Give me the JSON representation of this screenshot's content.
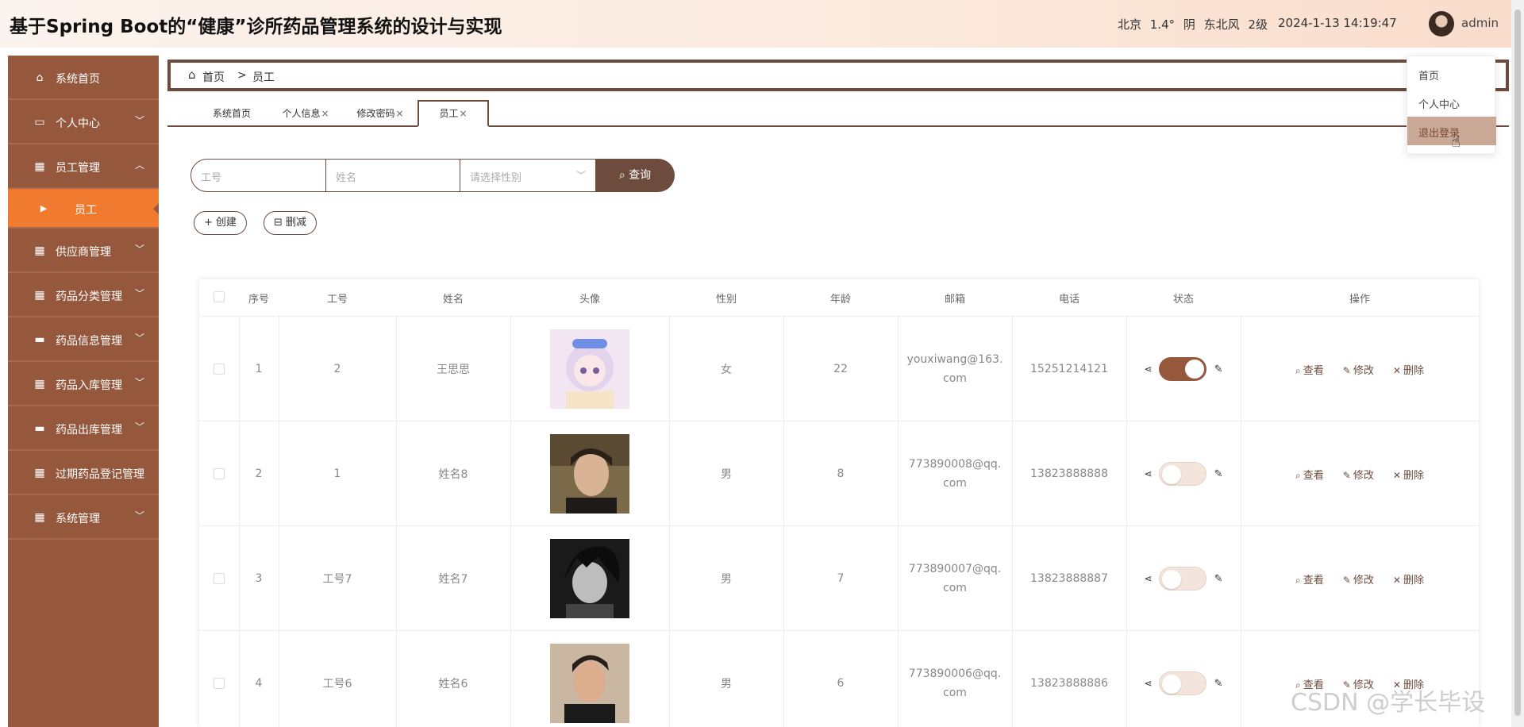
{
  "header": {
    "title": "基于Spring Boot的“健康”诊所药品管理系统的设计与实现",
    "weather": "北京 1.4° 阴 东北风 2级",
    "datetime": "2024-1-13 14:19:47",
    "username": "admin",
    "avatar_icon": "user-avatar"
  },
  "sidebar": {
    "items": [
      {
        "label": "系统首页",
        "icon": "home-icon",
        "glyph": "⌂"
      },
      {
        "label": "个人中心",
        "icon": "card-icon",
        "glyph": "▭"
      },
      {
        "label": "员工管理",
        "icon": "grid-icon",
        "glyph": "▦"
      },
      {
        "label": "员工",
        "icon": "caret-right-icon",
        "glyph": "▶"
      },
      {
        "label": "供应商管理",
        "icon": "grid-icon",
        "glyph": "▦"
      },
      {
        "label": "药品分类管理",
        "icon": "grid-icon",
        "glyph": "▦"
      },
      {
        "label": "药品信息管理",
        "icon": "chat-icon",
        "glyph": "▬"
      },
      {
        "label": "药品入库管理",
        "icon": "grid-icon",
        "glyph": "▦"
      },
      {
        "label": "药品出库管理",
        "icon": "monitor-icon",
        "glyph": "▬"
      },
      {
        "label": "过期药品登记管理",
        "icon": "grid-icon",
        "glyph": "▦"
      },
      {
        "label": "系统管理",
        "icon": "grid-icon",
        "glyph": "▦"
      }
    ],
    "bg_color": "#95583d",
    "active_color": "#f07b30"
  },
  "breadcrumb": {
    "home": "首页",
    "separator": ">",
    "current": "员工"
  },
  "tabs": [
    {
      "label": "系统首页",
      "closable": false
    },
    {
      "label": "个人信息",
      "closable": true
    },
    {
      "label": "修改密码",
      "closable": true
    },
    {
      "label": "员工",
      "closable": true
    }
  ],
  "search": {
    "field1_placeholder": "工号",
    "field2_placeholder": "姓名",
    "field3_placeholder": "请选择性别",
    "button": "查询"
  },
  "actions": {
    "create": "创建",
    "delete": "删减"
  },
  "table": {
    "headers": [
      "序号",
      "工号",
      "姓名",
      "头像",
      "性别",
      "年龄",
      "邮箱",
      "电话",
      "状态",
      "操作"
    ],
    "rows": [
      {
        "index": "1",
        "no": "2",
        "name": "王思思",
        "gender": "女",
        "age": "22",
        "email": "youxiwang@163.com",
        "phone": "15251214121",
        "status_on": true
      },
      {
        "index": "2",
        "no": "1",
        "name": "姓名8",
        "gender": "男",
        "age": "8",
        "email": "773890008@qq.com",
        "phone": "13823888888",
        "status_on": false
      },
      {
        "index": "3",
        "no": "工号7",
        "name": "姓名7",
        "gender": "男",
        "age": "7",
        "email": "773890007@qq.com",
        "phone": "13823888887",
        "status_on": false
      },
      {
        "index": "4",
        "no": "工号6",
        "name": "姓名6",
        "gender": "男",
        "age": "6",
        "email": "773890006@qq.com",
        "phone": "13823888886",
        "status_on": false
      }
    ],
    "ops": {
      "view": "查看",
      "edit": "修改",
      "delete": "删除"
    }
  },
  "dropdown": {
    "items": [
      "首页",
      "个人中心",
      "退出登录"
    ]
  },
  "watermark": "CSDN @学长毕设",
  "colors": {
    "brand": "#6d4c3d",
    "accent": "#f07b30",
    "toggle_on": "#95583d"
  }
}
